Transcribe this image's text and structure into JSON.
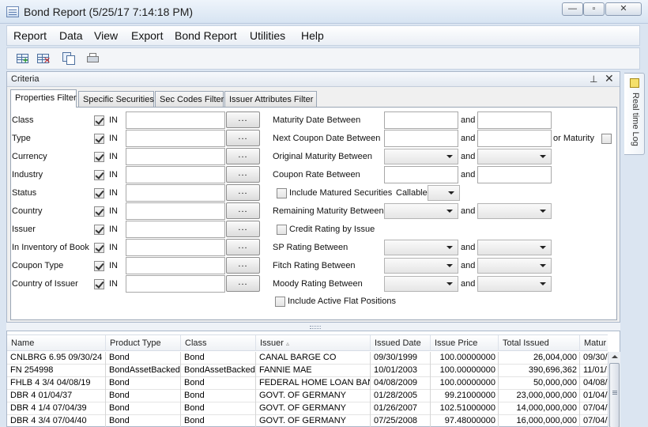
{
  "window": {
    "title": "Bond Report (5/25/17 7:14:18 PM)",
    "min": "—",
    "max": "▫",
    "close": "✕"
  },
  "menu": [
    "Report",
    "Data",
    "View",
    "Export",
    "Bond Report",
    "Utilities",
    "Help"
  ],
  "criteria": {
    "title": "Criteria",
    "pin": "⊥",
    "close": "✕",
    "tabs": [
      "Properties Filter",
      "Specific Securities",
      "Sec Codes Filter",
      "Issuer Attributes Filter"
    ],
    "in_label": "IN",
    "dots": "...",
    "filters": [
      "Class",
      "Type",
      "Currency",
      "Industry",
      "Status",
      "Country",
      "Issuer",
      "In Inventory of Book",
      "Coupon Type",
      "Country of Issuer"
    ],
    "and_label": "and",
    "maturity_date": "Maturity Date Between",
    "next_coupon": "Next Coupon Date Between",
    "or_maturity": "or Maturity",
    "original_maturity": "Original Maturity Between",
    "coupon_rate": "Coupon Rate Between",
    "include_matured": "Include Matured Securities",
    "callable": "Callable",
    "remaining_maturity": "Remaining Maturity Between",
    "credit_rating": "Credit Rating by Issue",
    "sp_rating": "SP Rating Between",
    "fitch_rating": "Fitch Rating Between",
    "moody_rating": "Moody Rating Between",
    "include_flat": "Include Active Flat Positions"
  },
  "grid": {
    "columns": [
      "Name",
      "Product Type",
      "Class",
      "Issuer",
      "Issued Date",
      "Issue Price",
      "Total Issued",
      "Matur"
    ],
    "sort_caret": "▵",
    "rows": [
      [
        "CNLBRG 6.95 09/30/24",
        "Bond",
        "Bond",
        "CANAL BARGE CO",
        "09/30/1999",
        "100.00000000",
        "26,004,000",
        "09/30/"
      ],
      [
        "FN 254998",
        "BondAssetBacked",
        "BondAssetBacked",
        "FANNIE MAE",
        "10/01/2003",
        "100.00000000",
        "390,696,362",
        "11/01/"
      ],
      [
        "FHLB 4 3/4 04/08/19",
        "Bond",
        "Bond",
        "FEDERAL HOME LOAN BANK",
        "04/08/2009",
        "100.00000000",
        "50,000,000",
        "04/08/"
      ],
      [
        "DBR 4 01/04/37",
        "Bond",
        "Bond",
        "GOVT. OF GERMANY",
        "01/28/2005",
        "99.21000000",
        "23,000,000,000",
        "01/04/"
      ],
      [
        "DBR 4 1/4 07/04/39",
        "Bond",
        "Bond",
        "GOVT. OF GERMANY",
        "01/26/2007",
        "102.51000000",
        "14,000,000,000",
        "07/04/"
      ],
      [
        "DBR 4 3/4 07/04/40",
        "Bond",
        "Bond",
        "GOVT. OF GERMANY",
        "07/25/2008",
        "97.48000000",
        "16,000,000,000",
        "07/04/"
      ]
    ]
  },
  "rail": {
    "label": "Real time Log"
  }
}
